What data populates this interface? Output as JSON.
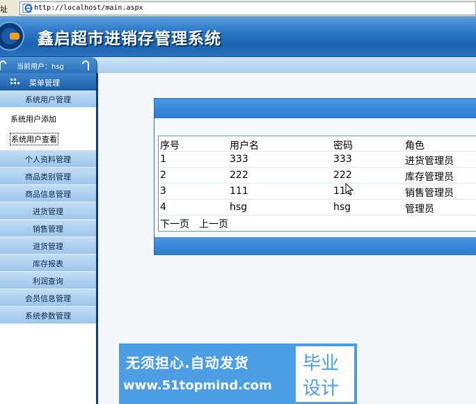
{
  "browser": {
    "address_label": "址",
    "url": "http://localhost/main.aspx",
    "page_icon": "ie-page-icon"
  },
  "header": {
    "title": "鑫启超市进销存管理系统",
    "logo_icon": "circle-logo-icon"
  },
  "userbar": {
    "current_user_text": "当前用户：hsg"
  },
  "sidebar": {
    "menu_header": "菜单管理",
    "items": [
      {
        "label": "系统用户管理",
        "type": "group"
      },
      {
        "label": "系统用户添加",
        "type": "sub"
      },
      {
        "label": "系统用户查看",
        "type": "sub",
        "active": true
      },
      {
        "label": "个人资料管理",
        "type": "group"
      },
      {
        "label": "商品类别管理",
        "type": "group"
      },
      {
        "label": "商品信息管理",
        "type": "group"
      },
      {
        "label": "进货管理",
        "type": "group"
      },
      {
        "label": "销售管理",
        "type": "group"
      },
      {
        "label": "退货管理",
        "type": "group"
      },
      {
        "label": "库存报表",
        "type": "group"
      },
      {
        "label": "利润查询",
        "type": "group"
      },
      {
        "label": "会员信息管理",
        "type": "group"
      },
      {
        "label": "系统参数管理",
        "type": "group"
      }
    ]
  },
  "table": {
    "columns": [
      "序号",
      "用户名",
      "密码",
      "角色"
    ],
    "rows": [
      [
        "1",
        "333",
        "333",
        "进货管理员"
      ],
      [
        "2",
        "222",
        "222",
        "库存管理员"
      ],
      [
        "3",
        "111",
        "111",
        "销售管理员"
      ],
      [
        "4",
        "hsg",
        "hsg",
        "管理员"
      ]
    ],
    "pager_next": "下一页",
    "pager_prev": "上一页"
  },
  "watermark": {
    "line1": "无须担心.自动发货",
    "line2": "www.51topmind.com",
    "box_line1": "毕业",
    "box_line2": "设计"
  },
  "colors": {
    "header_blue": "#1c63b0",
    "panel_blue": "#2b7ad0",
    "nav_blue": "#9cc6ec"
  }
}
